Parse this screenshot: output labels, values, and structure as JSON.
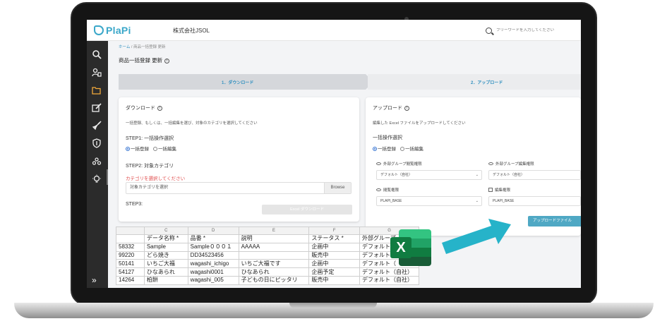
{
  "header": {
    "logo_text": "PlaPi",
    "company": "株式会社JSOL",
    "search_placeholder": "フリーワードを入力してください"
  },
  "sidebar": {
    "icons": [
      "search-icon",
      "users-icon",
      "folder-icon",
      "edit-icon",
      "rocket-icon",
      "shield-icon",
      "team-icon",
      "bulb-icon"
    ],
    "expand_label": "»"
  },
  "breadcrumb": {
    "home": "ホーム",
    "separator": "/",
    "current": "商品一括登録 更新"
  },
  "page": {
    "title": "商品一括登録 更新"
  },
  "steps": [
    {
      "label": "1．ダウンロード"
    },
    {
      "label": "2．アップロード"
    }
  ],
  "download": {
    "title": "ダウンロード",
    "description": "一括登録、もしくは、一括編集を選び、対象のカテゴリを選択してください",
    "step1_label": "STEP1: 一括操作選択",
    "radio_register": "一括登録",
    "radio_edit": "一括編集",
    "step2_label": "STEP2: 対象カテゴリ",
    "warning": "カテゴリを選択してください",
    "category_placeholder": "対象カテゴリを選択",
    "browse_label": "Browse",
    "step3_label": "STEP3:",
    "download_button": "Excel ダウンロード"
  },
  "upload": {
    "title": "アップロード",
    "description": "編集した Excel ファイルをアップロードしてください",
    "op_label": "一括操作選択",
    "radio_register": "一括登録",
    "radio_edit": "一括編集",
    "fields": [
      {
        "label": "外部グループ閲覧権限",
        "value": "デフォルト（自社）"
      },
      {
        "label": "外部グループ編集権限",
        "value": "デフォルト（自社）"
      },
      {
        "label": "閲覧権限",
        "value": "PLAPI_BASE"
      },
      {
        "label": "編集権限",
        "value": "PLAPI_BASE"
      }
    ],
    "upload_button": "アップロードファイル"
  },
  "sheet": {
    "columns": [
      "",
      "C",
      "D",
      "E",
      "F",
      "G"
    ],
    "header": [
      "",
      "データ名称 *",
      "品番 *",
      "説明",
      "ステータス *",
      "外部グループ"
    ],
    "rows": [
      [
        "58332",
        "Sample",
        "Sample０００１",
        "AAAAA",
        "企画中",
        "デフォルト"
      ],
      [
        "99220",
        "どら焼き",
        "DD34523456",
        "",
        "販売中",
        "デフォルト"
      ],
      [
        "50141",
        "いちご大福",
        "wagashi_ichigo",
        "いちご大福です",
        "企画中",
        "デフォルト（"
      ],
      [
        "54127",
        "ひなあられ",
        "wagashi0001",
        "ひなあられ",
        "企画予定",
        "デフォルト（自社）"
      ],
      [
        "14264",
        "柏餅",
        "wagashi_005",
        "子どもの日にピッタリ",
        "販売中",
        "デフォルト（自社）"
      ]
    ]
  },
  "excel_icon": {
    "letter": "X"
  },
  "colors": {
    "accent": "#3aa7c9",
    "sidebar": "#2b2b2b",
    "active_icon": "#f2a93b",
    "warning": "#e04a4a",
    "excel": "#107c41",
    "arrow": "#26b3c9"
  }
}
